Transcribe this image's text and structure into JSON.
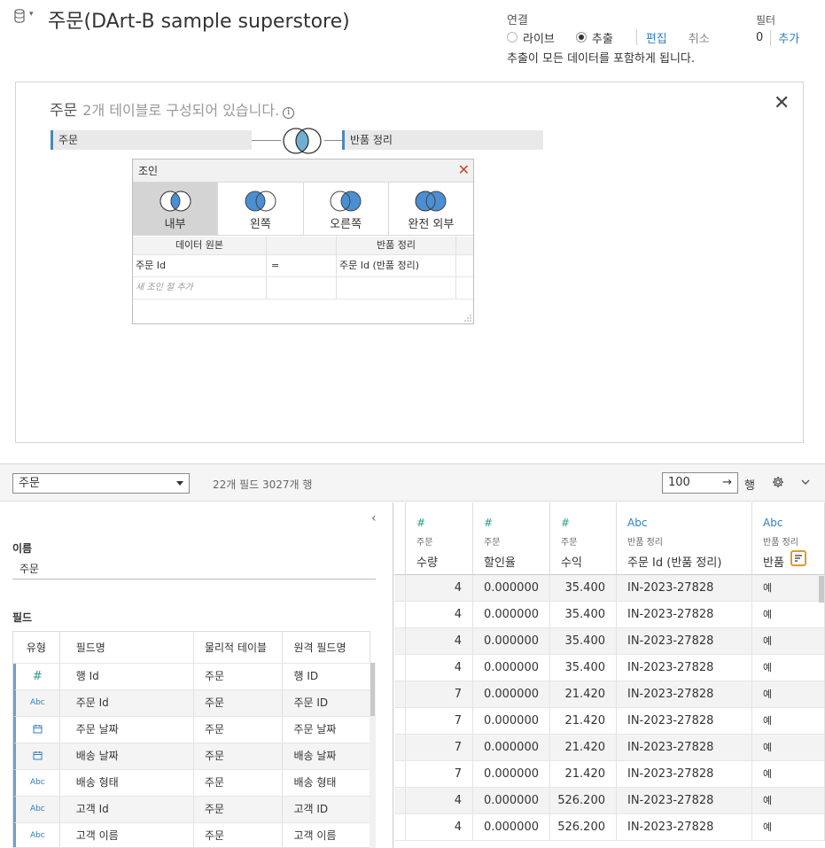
{
  "header": {
    "title": "주문(DArt-B sample superstore)",
    "connection_label": "연결",
    "live_label": "라이브",
    "extract_label": "추출",
    "edit_label": "편집",
    "cancel_label": "취소",
    "extract_note": "추출이 모든 데이터를 포함하게 됩니다.",
    "filter_label": "필터",
    "filter_count": "0",
    "filter_add": "추가"
  },
  "canvas": {
    "table_name": "주문",
    "subtitle": "2개 테이블로 구성되어 있습니다.",
    "left_table": "주문",
    "right_table": "반품 정리"
  },
  "join": {
    "title": "조인",
    "types": [
      {
        "label": "내부",
        "selected": true
      },
      {
        "label": "왼쪽",
        "selected": false
      },
      {
        "label": "오른쪽",
        "selected": false
      },
      {
        "label": "완전 외부",
        "selected": false
      }
    ],
    "col_left": "데이터 원본",
    "col_right": "반품 정리",
    "clause_left": "주문 Id",
    "clause_op": "=",
    "clause_right": "주문 Id (반품 정리)",
    "add_clause": "새 조인 절 추가"
  },
  "toolbar": {
    "table_select": "주문",
    "field_count": "22개 필드 3027개 행",
    "rows_value": "100",
    "rows_arrow": "→",
    "rows_label": "행"
  },
  "meta": {
    "name_label": "이름",
    "name_value": "주문",
    "fields_label": "필드",
    "headers": [
      "유형",
      "필드명",
      "물리적 테이블",
      "원격 필드명"
    ],
    "rows": [
      {
        "type": "#",
        "type_kind": "num",
        "field": "행 Id",
        "table": "주문",
        "remote": "행 ID"
      },
      {
        "type": "Abc",
        "type_kind": "abc",
        "field": "주문 Id",
        "table": "주문",
        "remote": "주문 ID"
      },
      {
        "type": "📅",
        "type_kind": "date",
        "field": "주문 날짜",
        "table": "주문",
        "remote": "주문 날짜"
      },
      {
        "type": "📅",
        "type_kind": "date",
        "field": "배송 날짜",
        "table": "주문",
        "remote": "배송 날짜"
      },
      {
        "type": "Abc",
        "type_kind": "abc",
        "field": "배송 형태",
        "table": "주문",
        "remote": "배송 형태"
      },
      {
        "type": "Abc",
        "type_kind": "abc",
        "field": "고객 Id",
        "table": "주문",
        "remote": "고객 ID"
      },
      {
        "type": "Abc",
        "type_kind": "abc",
        "field": "고객 이름",
        "table": "주문",
        "remote": "고객 이름"
      }
    ]
  },
  "grid": {
    "columns": [
      {
        "type": "#",
        "source": "주문",
        "name": "수량"
      },
      {
        "type": "#",
        "source": "주문",
        "name": "할인율"
      },
      {
        "type": "#",
        "source": "주문",
        "name": "수익"
      },
      {
        "type": "Abc",
        "source": "반품 정리",
        "name": "주문 Id (반품 정리)"
      },
      {
        "type": "Abc",
        "source": "반품 정리",
        "name": "반품"
      }
    ],
    "rows": [
      [
        "4",
        "0.000000",
        "35.400",
        "IN-2023-27828",
        "예"
      ],
      [
        "4",
        "0.000000",
        "35.400",
        "IN-2023-27828",
        "예"
      ],
      [
        "4",
        "0.000000",
        "35.400",
        "IN-2023-27828",
        "예"
      ],
      [
        "4",
        "0.000000",
        "35.400",
        "IN-2023-27828",
        "예"
      ],
      [
        "7",
        "0.000000",
        "21.420",
        "IN-2023-27828",
        "예"
      ],
      [
        "7",
        "0.000000",
        "21.420",
        "IN-2023-27828",
        "예"
      ],
      [
        "7",
        "0.000000",
        "21.420",
        "IN-2023-27828",
        "예"
      ],
      [
        "7",
        "0.000000",
        "21.420",
        "IN-2023-27828",
        "예"
      ],
      [
        "4",
        "0.000000",
        "526.200",
        "IN-2023-27828",
        "예"
      ],
      [
        "4",
        "0.000000",
        "526.200",
        "IN-2023-27828",
        "예"
      ]
    ]
  },
  "colors": {
    "accent": "#2f7fc1",
    "venn": "#4a8fd4",
    "sort_highlight": "#e09a2b"
  }
}
